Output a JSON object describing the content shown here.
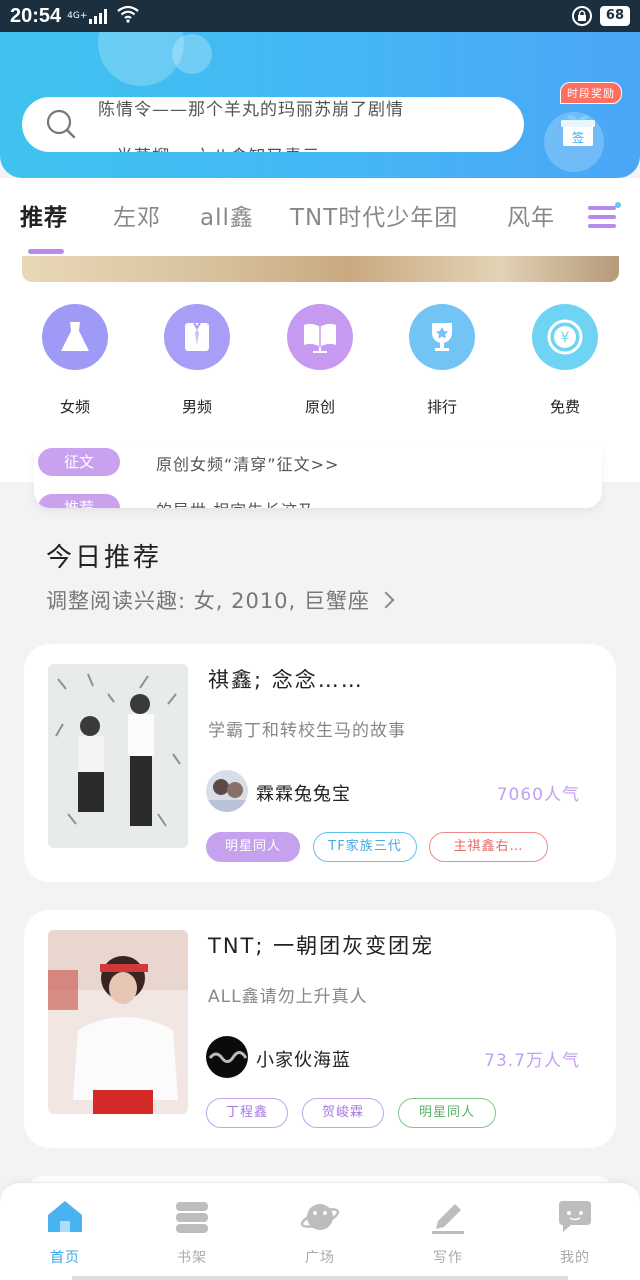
{
  "status_bar": {
    "time": "20:54",
    "network": "4G+",
    "battery": "68"
  },
  "header": {
    "search_lines": [
      "陈情令——那个羊丸的玛丽苏崩了剧情",
      "一半草榴 一六八食知又青示"
    ],
    "reward_badge": "时段奖励",
    "sign_label": "签"
  },
  "tabs": [
    "推荐",
    "左邓",
    "all鑫",
    "TNT时代少年团",
    "风年"
  ],
  "categories": [
    {
      "label": "女频",
      "icon": "dress-icon",
      "color": "#9f9af5"
    },
    {
      "label": "男频",
      "icon": "shirt-icon",
      "color": "#a89ef7"
    },
    {
      "label": "原创",
      "icon": "book-icon",
      "color": "#c79af2"
    },
    {
      "label": "排行",
      "icon": "trophy-icon",
      "color": "#72c4f5"
    },
    {
      "label": "免费",
      "icon": "yuan-icon",
      "color": "#6fd3f3"
    }
  ],
  "notices": [
    {
      "tag": "征文",
      "text": "原创女频“清穿”征文>>"
    },
    {
      "tag": "推荐",
      "text": "的异世·相宜生长这乃·"
    }
  ],
  "today": {
    "title": "今日推荐",
    "subtitle": "调整阅读兴趣: 女, 2010, 巨蟹座"
  },
  "books": [
    {
      "title": "祺鑫; 念念……",
      "desc": "学霸丁和转校生马的故事",
      "author": "霖霖兔兔宝",
      "popularity": "7060人气",
      "tags": [
        {
          "label": "明星同人",
          "style": "filled-purple"
        },
        {
          "label": "TF家族三代",
          "style": "outline-blue"
        },
        {
          "label": "主祺鑫右…",
          "style": "outline-red"
        }
      ]
    },
    {
      "title": "TNT; 一朝团灰变团宠",
      "desc": "ALL鑫请勿上升真人",
      "author": "小家伙海蓝",
      "popularity": "73.7万人气",
      "tags": [
        {
          "label": "丁程鑫",
          "style": "outline-purple"
        },
        {
          "label": "贺峻霖",
          "style": "outline-purple"
        },
        {
          "label": "明星同人",
          "style": "outline-green"
        }
      ]
    }
  ],
  "bottom_nav": [
    {
      "label": "首页",
      "icon": "home-icon",
      "active": true
    },
    {
      "label": "书架",
      "icon": "bookshelf-icon",
      "active": false
    },
    {
      "label": "广场",
      "icon": "planet-icon",
      "active": false
    },
    {
      "label": "写作",
      "icon": "pen-icon",
      "active": false
    },
    {
      "label": "我的",
      "icon": "chat-icon",
      "active": false
    }
  ],
  "colors": {
    "accent": "#3aa8f0",
    "purple": "#b88af0",
    "header_start": "#3fc3ee",
    "header_end": "#4aa6f7"
  }
}
